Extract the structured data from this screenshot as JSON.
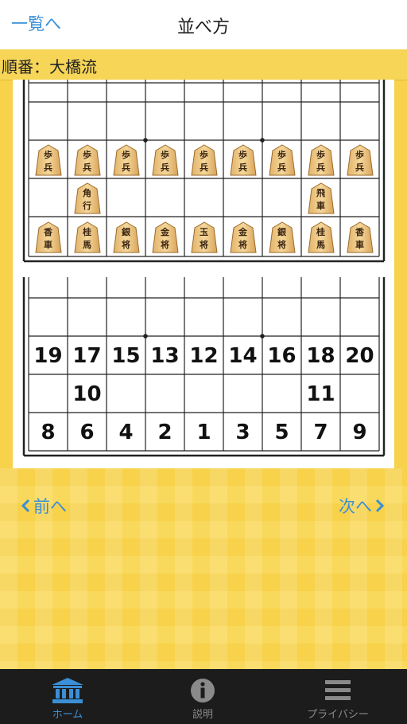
{
  "nav": {
    "back_label": "一覧へ",
    "title": "並べ方"
  },
  "subheader": {
    "text": "順番：大橋流"
  },
  "pieces_row_pawns": [
    [
      "歩",
      "兵"
    ],
    [
      "歩",
      "兵"
    ],
    [
      "歩",
      "兵"
    ],
    [
      "歩",
      "兵"
    ],
    [
      "歩",
      "兵"
    ],
    [
      "歩",
      "兵"
    ],
    [
      "歩",
      "兵"
    ],
    [
      "歩",
      "兵"
    ],
    [
      "歩",
      "兵"
    ]
  ],
  "pieces_row_major": [
    {
      "col": 1,
      "chars": [
        "角",
        "行"
      ]
    },
    {
      "col": 7,
      "chars": [
        "飛",
        "車"
      ]
    }
  ],
  "pieces_row_back": [
    [
      "香",
      "車"
    ],
    [
      "桂",
      "馬"
    ],
    [
      "銀",
      "将"
    ],
    [
      "金",
      "将"
    ],
    [
      "玉",
      "将"
    ],
    [
      "金",
      "将"
    ],
    [
      "銀",
      "将"
    ],
    [
      "桂",
      "馬"
    ],
    [
      "香",
      "車"
    ]
  ],
  "order_row_pawns": [
    "19",
    "17",
    "15",
    "13",
    "12",
    "14",
    "16",
    "18",
    "20"
  ],
  "order_row_major": [
    {
      "col": 1,
      "num": "10"
    },
    {
      "col": 7,
      "num": "11"
    }
  ],
  "order_row_back": [
    "8",
    "6",
    "4",
    "2",
    "1",
    "3",
    "5",
    "7",
    "9"
  ],
  "pager": {
    "prev_label": "前へ",
    "next_label": "次へ"
  },
  "tabs": [
    {
      "label": "ホーム",
      "icon": "bank-icon",
      "active": true
    },
    {
      "label": "説明",
      "icon": "info-icon",
      "active": false
    },
    {
      "label": "プライバシー",
      "icon": "menu-icon",
      "active": false
    }
  ],
  "colors": {
    "accent": "#3a8fd6",
    "yellow": "#f7d24a",
    "tab_active": "#3a8fd6",
    "tab_inactive": "#8a8a8a"
  }
}
